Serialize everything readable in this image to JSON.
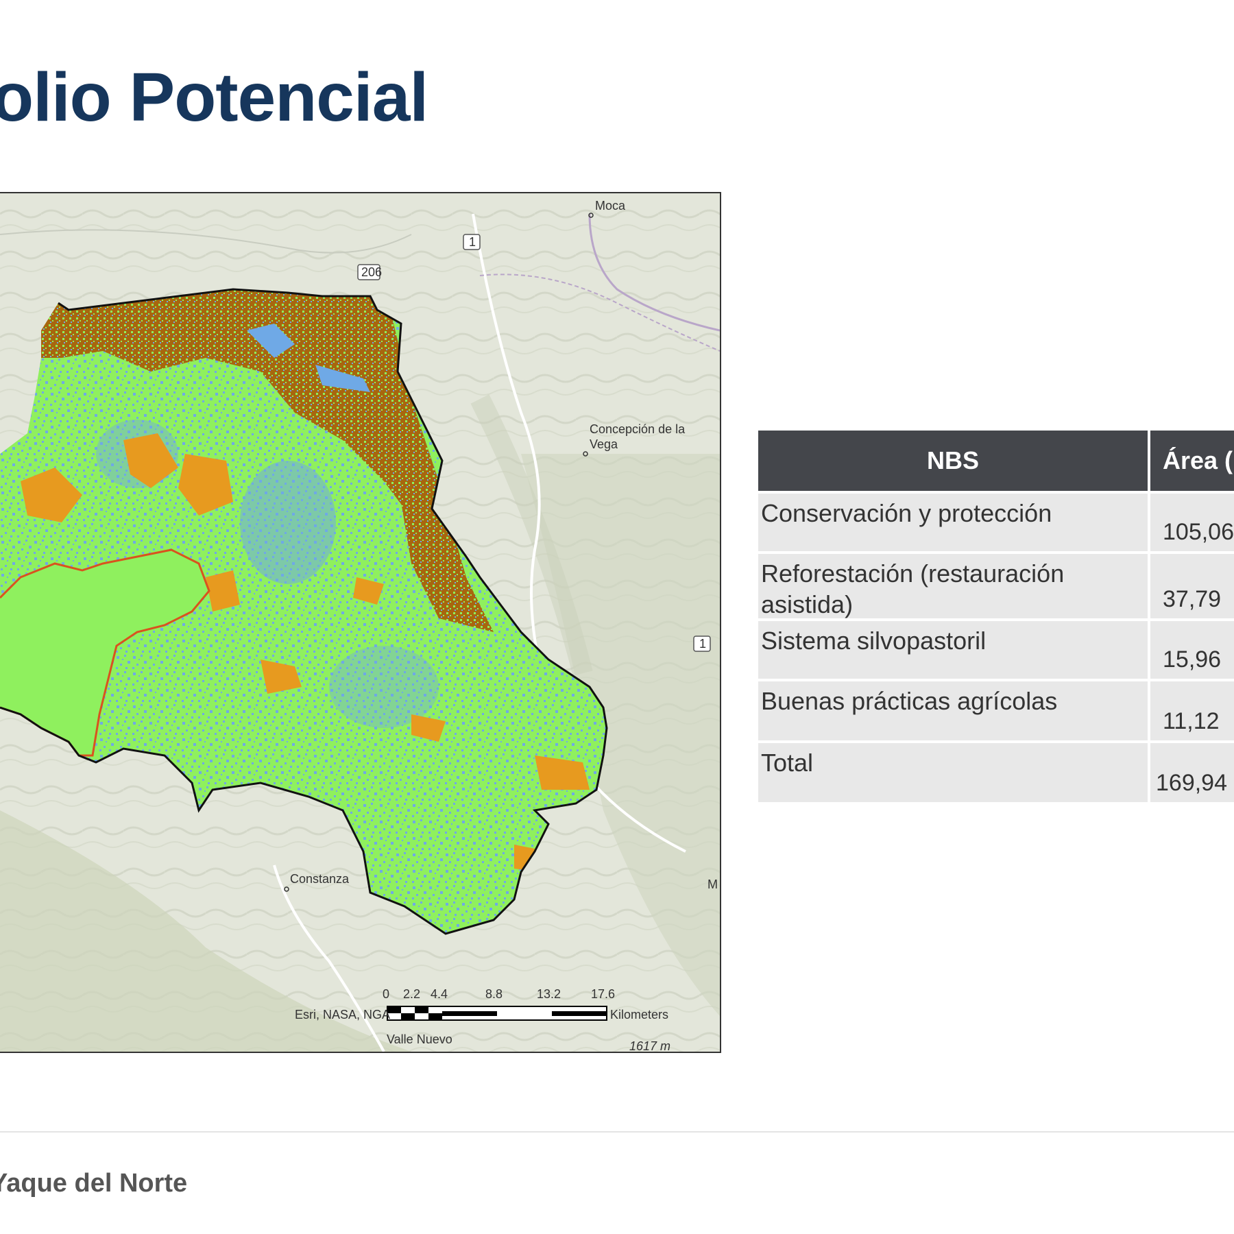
{
  "page": {
    "title": "olio Potencial",
    "footer": "Yaque del Norte"
  },
  "map": {
    "places": {
      "moca": "Moca",
      "concepcion_line1": "Concepción de la",
      "concepcion_line2": "Vega",
      "constanza": "Constanza",
      "valle_nuevo": "Valle Nuevo",
      "m_edge": "M",
      "elevation": "1617 m"
    },
    "road_shields": [
      "1",
      "206",
      "1"
    ],
    "scale_bar": {
      "ticks": [
        "0",
        "2.2",
        "4.4",
        "8.8",
        "13.2",
        "17.6"
      ],
      "unit": "Kilometers"
    },
    "attribution": "Esri, NASA, NGA",
    "colors": {
      "conservation": "#8ff05e",
      "reforestation": "#6fa9e6",
      "silvopastoral": "#e79a1f",
      "agricultural": "#a8660e",
      "boundary": "#111111",
      "subbasin": "#d9531e",
      "terrain": "#e5e8dd"
    }
  },
  "table": {
    "header": {
      "nbs": "NBS",
      "area": "Área ("
    },
    "rows": [
      {
        "nbs": "Conservación y protección",
        "area": "105,06"
      },
      {
        "nbs": "Reforestación (restauración asistida)",
        "area": "37,79"
      },
      {
        "nbs": "Sistema silvopastoril",
        "area": "15,96"
      },
      {
        "nbs": "Buenas prácticas agrícolas",
        "area": "11,12"
      },
      {
        "nbs": "Total",
        "area": "169,94"
      }
    ]
  }
}
